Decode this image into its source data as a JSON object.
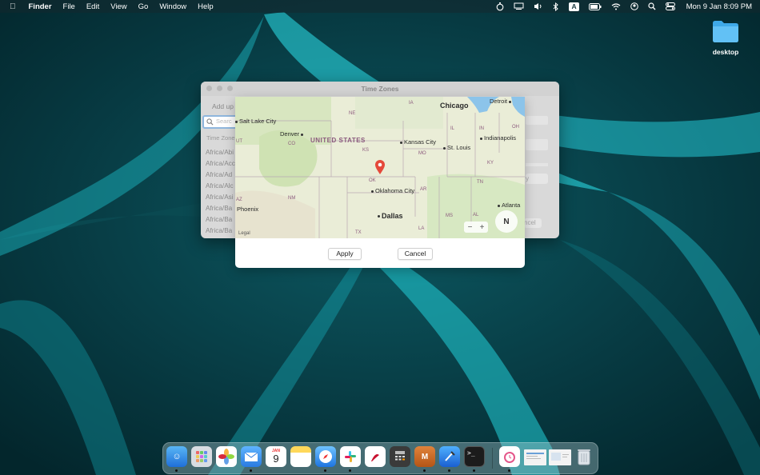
{
  "menubar": {
    "app_menus": [
      "Finder",
      "File",
      "Edit",
      "View",
      "Go",
      "Window",
      "Help"
    ],
    "status_icons": [
      "timer-icon",
      "display-icon",
      "volume-icon",
      "bluetooth-icon",
      "input-source-icon",
      "battery-icon",
      "wifi-icon",
      "user-icon",
      "spotlight-icon",
      "control-center-icon"
    ],
    "input_source_label": "A",
    "clock": "Mon 9 Jan  8:09 PM"
  },
  "desktop": {
    "folder_label": "desktop"
  },
  "bg_window": {
    "title": "Time Zones",
    "add_label": "Add up",
    "search_placeholder": "Searc",
    "column_header": "Time Zone",
    "rows": [
      "Africa/Abi",
      "Africa/Acc",
      "Africa/Ad",
      "Africa/Alc",
      "Africa/Asi",
      "Africa/Ba",
      "Africa/Ba",
      "Africa/Ba"
    ],
    "apply_label": "y",
    "cancel_label": "ncel"
  },
  "map": {
    "cities": [
      {
        "name": "Chicago",
        "big": true
      },
      {
        "name": "Detroit",
        "big": false
      },
      {
        "name": "Salt Lake City",
        "big": false
      },
      {
        "name": "Denver",
        "big": false
      },
      {
        "name": "Kansas City",
        "big": false
      },
      {
        "name": "St. Louis",
        "big": false
      },
      {
        "name": "Indianapolis",
        "big": false
      },
      {
        "name": "Oklahoma City",
        "big": false
      },
      {
        "name": "Phoenix",
        "big": false
      },
      {
        "name": "Dallas",
        "big": true
      },
      {
        "name": "Atlanta",
        "big": false
      }
    ],
    "country_label": "UNITED STATES",
    "states": [
      "IA",
      "NE",
      "IL",
      "IN",
      "OH",
      "UT",
      "CO",
      "KS",
      "MO",
      "KY",
      "OK",
      "AR",
      "TN",
      "AZ",
      "NM",
      "MS",
      "AL",
      "TX",
      "LA"
    ],
    "zoom_out": "−",
    "zoom_in": "+",
    "compass": "N",
    "legal": "Legal",
    "accent_pin": "#e5493a"
  },
  "dialog": {
    "apply_label": "Apply",
    "cancel_label": "Cancel"
  },
  "dock": {
    "apps": [
      "finder",
      "launchpad",
      "photos",
      "mail",
      "calendar",
      "notes",
      "safari",
      "slack",
      "pdf-reader",
      "calculator",
      "mamp",
      "xcode",
      "terminal",
      "time-app",
      "preview-doc-1",
      "preview-doc-2",
      "trash"
    ],
    "calendar_month": "JAN",
    "calendar_day": "9"
  }
}
